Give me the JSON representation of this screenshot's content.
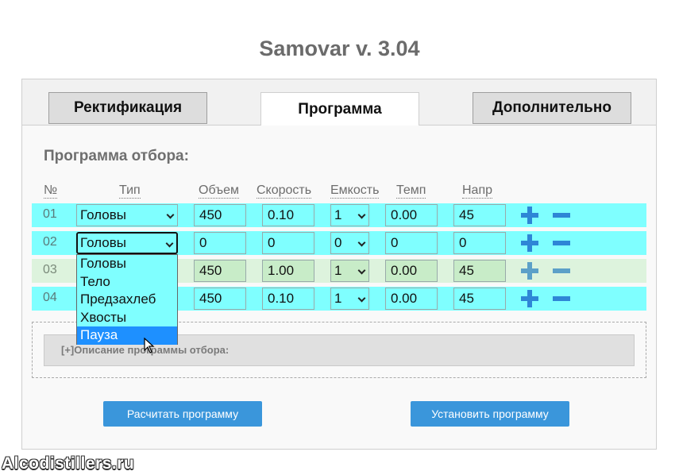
{
  "app_title": "Samovar v. 3.04",
  "tabs": [
    {
      "label": "Ректификация",
      "active": false
    },
    {
      "label": "Программа",
      "active": true
    },
    {
      "label": "Дополнительно",
      "active": false
    }
  ],
  "section_title": "Программа отбора:",
  "columns": [
    "№",
    "Тип",
    "Объем",
    "Скорость",
    "Емкость",
    "Темп",
    "Напр"
  ],
  "rows": [
    {
      "num": "01",
      "type": "Головы",
      "volume": "450",
      "speed": "0.10",
      "tank": "1",
      "temp": "0.00",
      "voltage": "45"
    },
    {
      "num": "02",
      "type": "Головы",
      "volume": "0",
      "speed": "0",
      "tank": "0",
      "temp": "0",
      "voltage": "0"
    },
    {
      "num": "03",
      "type": "",
      "volume": "450",
      "speed": "1.00",
      "tank": "1",
      "temp": "0.00",
      "voltage": "45"
    },
    {
      "num": "04",
      "type": "",
      "volume": "450",
      "speed": "0.10",
      "tank": "1",
      "temp": "0.00",
      "voltage": "45"
    }
  ],
  "type_dropdown": {
    "options": [
      "Головы",
      "Тело",
      "Предзахлеб",
      "Хвосты",
      "Пауза"
    ],
    "highlighted": "Пауза"
  },
  "description_toggle": "[+]",
  "description_label": "Описание программы отбора:",
  "buttons": {
    "calculate": "Расчитать программу",
    "install": "Установить программу"
  },
  "watermark": "Alcodistillers.ru",
  "colors": {
    "row_bg": "#7fffff",
    "row_dim_bg": "#ddf3dd",
    "accent_blue": "#3a96db",
    "highlight": "#1e90ff"
  }
}
